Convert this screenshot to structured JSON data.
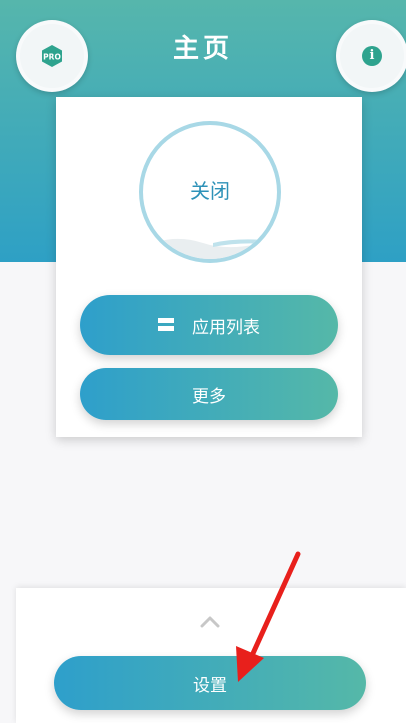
{
  "header": {
    "title": "主页",
    "pro_badge": "PRO",
    "info_icon": "i"
  },
  "main_card": {
    "status": "关闭",
    "app_list_label": "应用列表",
    "more_label": "更多"
  },
  "bottom": {
    "settings_label": "设置"
  },
  "colors": {
    "gradient_start": "#2ea0c5",
    "gradient_end": "#56b6ac",
    "annotation_arrow": "#e8201c"
  },
  "icons": [
    "pro-hexagon-icon",
    "info-icon",
    "list-icon",
    "chevron-up-icon"
  ]
}
